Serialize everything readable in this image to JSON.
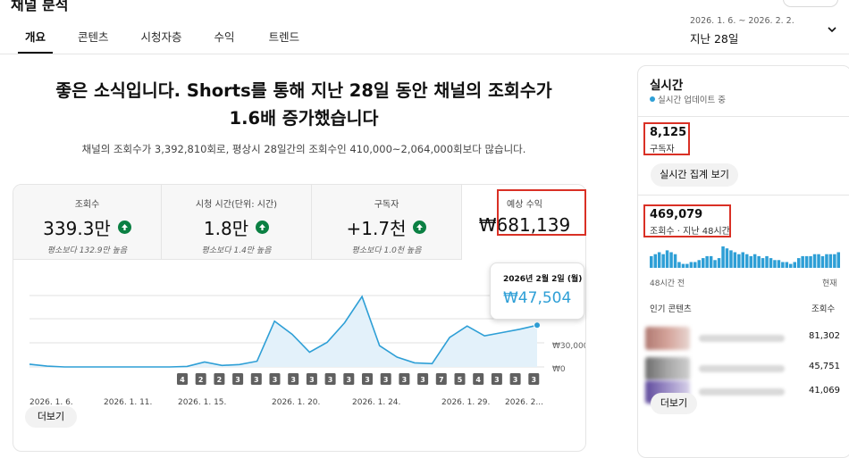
{
  "page": {
    "title": "채널 분석"
  },
  "tabs": [
    {
      "label": "개요"
    },
    {
      "label": "콘텐츠"
    },
    {
      "label": "시청자층"
    },
    {
      "label": "수익"
    },
    {
      "label": "트렌드"
    }
  ],
  "date_range": {
    "range": "2026. 1. 6. ~ 2026. 2. 2.",
    "period": "지난 28일"
  },
  "headline": {
    "line1": "좋은 소식입니다. Shorts를 통해 지난 28일 동안 채널의 조회수가",
    "line2": "1.6배 증가했습니다"
  },
  "subline": "채널의 조회수가 3,392,810회로, 평상시 28일간의 조회수인 410,000~2,064,000회보다 많습니다.",
  "metrics": [
    {
      "label": "조회수",
      "value": "339.3만",
      "sub": "평소보다 132.9만 높음"
    },
    {
      "label": "시청 시간(단위: 시간)",
      "value": "1.8만",
      "sub": "평소보다 1.4만 높음"
    },
    {
      "label": "구독자",
      "value": "+1.7천",
      "sub": "평소보다 1.0천 높음"
    },
    {
      "label": "예상 수익",
      "value": "₩681,139"
    }
  ],
  "tooltip": {
    "date": "2026년 2월 2일 (월)",
    "value": "₩47,504"
  },
  "chart_data": {
    "type": "area",
    "x": [
      "2026. 1. 6.",
      "2026. 1. 7.",
      "2026. 1. 8.",
      "2026. 1. 9.",
      "2026. 1. 10.",
      "2026. 1. 11.",
      "2026. 1. 12.",
      "2026. 1. 13.",
      "2026. 1. 14.",
      "2026. 1. 15.",
      "2026. 1. 16.",
      "2026. 1. 17.",
      "2026. 1. 18.",
      "2026. 1. 19.",
      "2026. 1. 20.",
      "2026. 1. 21.",
      "2026. 1. 22.",
      "2026. 1. 23.",
      "2026. 1. 24.",
      "2026. 1. 25.",
      "2026. 1. 26.",
      "2026. 1. 27.",
      "2026. 1. 28.",
      "2026. 1. 29.",
      "2026. 1. 30.",
      "2026. 1. 31.",
      "2026. 2. 1.",
      "2026. 2. 2."
    ],
    "values": [
      1700,
      500,
      0,
      0,
      0,
      0,
      0,
      0,
      0,
      300,
      3000,
      900,
      1500,
      3500,
      28000,
      20000,
      9000,
      15000,
      27000,
      43000,
      13000,
      6000,
      2500,
      2000,
      18000,
      25000,
      19000,
      21000,
      23000,
      25500
    ],
    "xtick_labels": [
      "2026. 1. 6.",
      "2026. 1. 11.",
      "2026. 1. 15.",
      "2026. 1. 20.",
      "2026. 1. 24.",
      "2026. 1. 29.",
      "2026. 2..."
    ],
    "ytick_labels": [
      "₩30,000",
      "₩0"
    ],
    "ylim": [
      0,
      60000
    ],
    "badges": [
      "4",
      "2",
      "2",
      "3",
      "3",
      "3",
      "3",
      "3",
      "3",
      "3",
      "3",
      "3",
      "3",
      "3",
      "7",
      "5",
      "4",
      "3",
      "3",
      "3"
    ],
    "grid": true,
    "color": "#2e9fd6"
  },
  "more_label": "더보기",
  "realtime": {
    "title": "실시간",
    "status": "실시간 업데이트 중",
    "subs_value": "8,125",
    "subs_label": "구독자",
    "button": "실시간 집계 보기",
    "views_value": "469,079",
    "views_label": "조회수 · 지난 48시간",
    "spark_values": [
      6,
      7,
      8,
      7,
      9,
      8,
      7,
      3,
      2,
      2,
      3,
      3,
      4,
      5,
      6,
      6,
      4,
      5,
      11,
      10,
      9,
      8,
      7,
      8,
      7,
      6,
      7,
      6,
      5,
      6,
      5,
      4,
      4,
      3,
      3,
      2,
      3,
      5,
      6,
      6,
      6,
      7,
      7,
      6,
      7,
      7,
      7,
      8
    ],
    "axis_left": "48시간 전",
    "axis_right": "현재",
    "top_content_label": "인기 콘텐츠",
    "top_views_label": "조회수",
    "top_items": [
      {
        "views": "81,302"
      },
      {
        "views": "45,751"
      },
      {
        "views": "41,069"
      }
    ],
    "more_label": "더보기"
  },
  "colors": {
    "accent": "#2e9fd6",
    "up_green": "#0b8043",
    "highlight_red": "#d93025"
  }
}
